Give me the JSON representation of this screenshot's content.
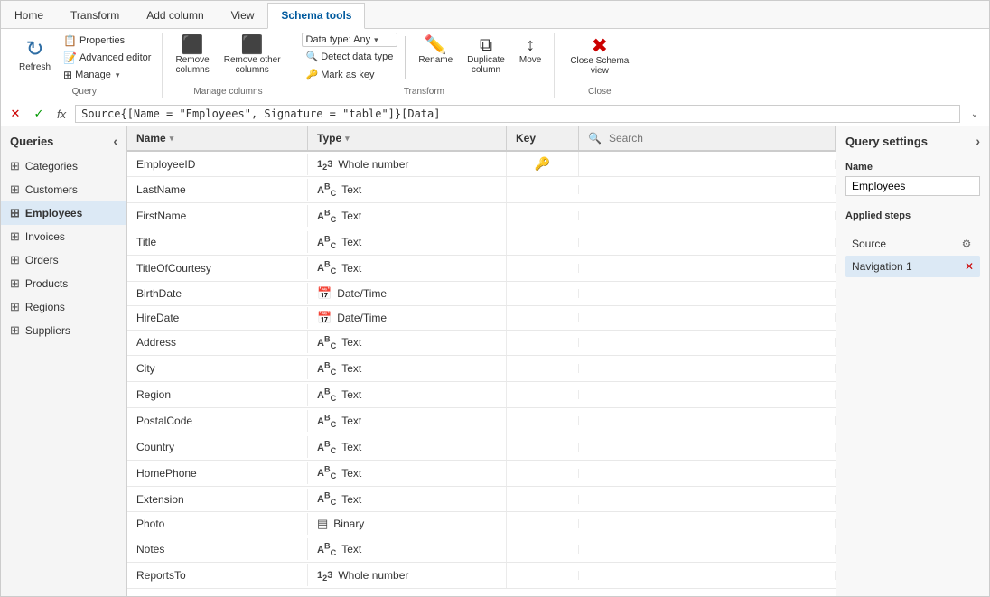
{
  "ribbon": {
    "tabs": [
      {
        "label": "Home",
        "active": false
      },
      {
        "label": "Transform",
        "active": false
      },
      {
        "label": "Add column",
        "active": false
      },
      {
        "label": "View",
        "active": false
      },
      {
        "label": "Schema tools",
        "active": true
      }
    ],
    "groups": {
      "query": {
        "label": "Query",
        "refresh_label": "Refresh",
        "properties_label": "Properties",
        "advanced_editor_label": "Advanced editor",
        "manage_label": "Manage",
        "manage_arrow": "▾"
      },
      "manage_columns": {
        "label": "Manage columns",
        "remove_columns_label": "Remove\ncolumns",
        "remove_other_columns_label": "Remove other\ncolumns"
      },
      "transform": {
        "label": "Transform",
        "data_type_label": "Data type: Any",
        "detect_label": "Detect data type",
        "mark_key_label": "Mark as key",
        "rename_label": "Rename",
        "duplicate_label": "Duplicate\ncolumn",
        "move_label": "Move"
      },
      "close": {
        "label": "Close",
        "close_schema_label": "Close Schema\nview"
      }
    }
  },
  "formula_bar": {
    "formula_text": "Source{[Name = \"Employees\", Signature = \"table\"]}[Data]"
  },
  "queries_panel": {
    "title": "Queries",
    "items": [
      {
        "label": "Categories",
        "active": false
      },
      {
        "label": "Customers",
        "active": false
      },
      {
        "label": "Employees",
        "active": true
      },
      {
        "label": "Invoices",
        "active": false
      },
      {
        "label": "Orders",
        "active": false
      },
      {
        "label": "Products",
        "active": false
      },
      {
        "label": "Regions",
        "active": false
      },
      {
        "label": "Suppliers",
        "active": false
      }
    ]
  },
  "grid": {
    "columns": [
      {
        "label": "Name",
        "sortable": true
      },
      {
        "label": "Type",
        "sortable": true
      },
      {
        "label": "Key",
        "sortable": false
      },
      {
        "label": "Search",
        "sortable": false
      }
    ],
    "rows": [
      {
        "name": "EmployeeID",
        "type": "Whole number",
        "type_icon": "123",
        "is_key": true
      },
      {
        "name": "LastName",
        "type": "Text",
        "type_icon": "ABC",
        "is_key": false
      },
      {
        "name": "FirstName",
        "type": "Text",
        "type_icon": "ABC",
        "is_key": false
      },
      {
        "name": "Title",
        "type": "Text",
        "type_icon": "ABC",
        "is_key": false
      },
      {
        "name": "TitleOfCourtesy",
        "type": "Text",
        "type_icon": "ABC",
        "is_key": false
      },
      {
        "name": "BirthDate",
        "type": "Date/Time",
        "type_icon": "DT",
        "is_key": false
      },
      {
        "name": "HireDate",
        "type": "Date/Time",
        "type_icon": "DT",
        "is_key": false
      },
      {
        "name": "Address",
        "type": "Text",
        "type_icon": "ABC",
        "is_key": false
      },
      {
        "name": "City",
        "type": "Text",
        "type_icon": "ABC",
        "is_key": false
      },
      {
        "name": "Region",
        "type": "Text",
        "type_icon": "ABC",
        "is_key": false
      },
      {
        "name": "PostalCode",
        "type": "Text",
        "type_icon": "ABC",
        "is_key": false
      },
      {
        "name": "Country",
        "type": "Text",
        "type_icon": "ABC",
        "is_key": false
      },
      {
        "name": "HomePhone",
        "type": "Text",
        "type_icon": "ABC",
        "is_key": false
      },
      {
        "name": "Extension",
        "type": "Text",
        "type_icon": "ABC",
        "is_key": false
      },
      {
        "name": "Photo",
        "type": "Binary",
        "type_icon": "BIN",
        "is_key": false
      },
      {
        "name": "Notes",
        "type": "Text",
        "type_icon": "ABC",
        "is_key": false
      },
      {
        "name": "ReportsTo",
        "type": "Whole number",
        "type_icon": "123",
        "is_key": false
      }
    ]
  },
  "settings_panel": {
    "title": "Query settings",
    "expand_icon": "›",
    "name_label": "Name",
    "name_value": "Employees",
    "applied_steps_label": "Applied steps",
    "steps": [
      {
        "label": "Source",
        "active": false,
        "has_gear": true,
        "has_delete": false
      },
      {
        "label": "Navigation 1",
        "active": true,
        "has_gear": false,
        "has_delete": true
      }
    ]
  }
}
